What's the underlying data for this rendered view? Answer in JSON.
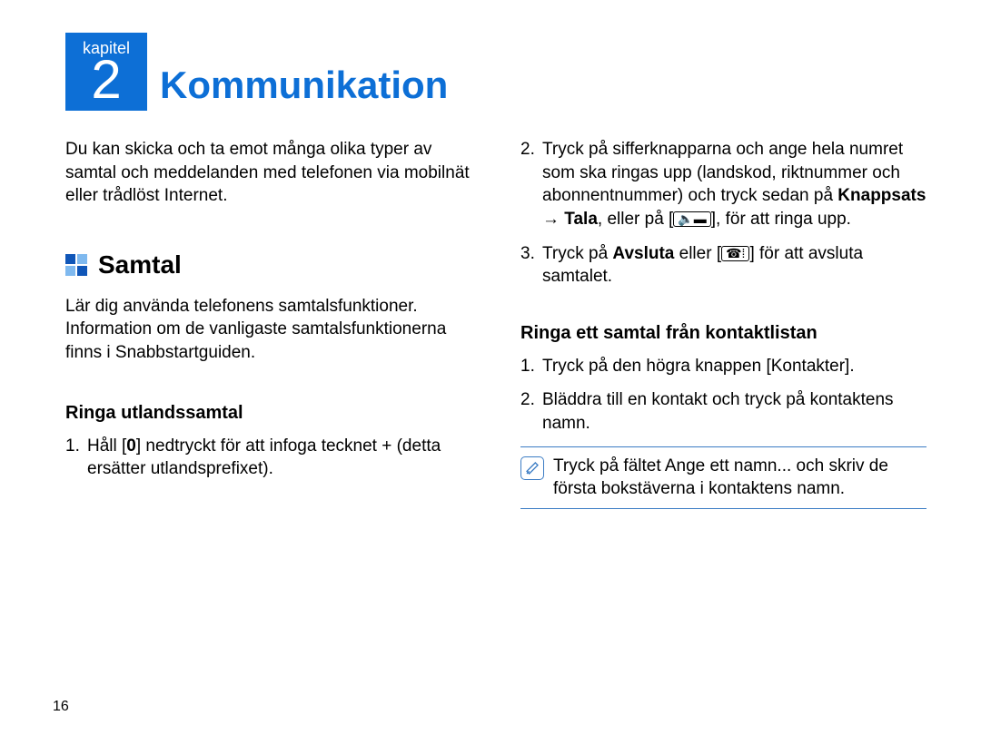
{
  "chapter": {
    "label": "kapitel",
    "number": "2",
    "title": "Kommunikation"
  },
  "left": {
    "intro": "Du kan skicka och ta emot många olika typer av samtal och meddelanden med telefonen via mobilnät eller trådlöst Internet.",
    "section_title": "Samtal",
    "section_text": "Lär dig använda telefonens samtalsfunktioner. Information om de vanligaste samtalsfunktionerna finns i Snabbstartguiden.",
    "sub1_title": "Ringa utlandssamtal",
    "sub1_item1_num": "1.",
    "sub1_item1_a": "Håll [",
    "sub1_item1_bold": "0",
    "sub1_item1_b": "] nedtryckt för att infoga tecknet + (detta ersätter utlandsprefixet)."
  },
  "right": {
    "item2_num": "2.",
    "item2_a": "Tryck på sifferknapparna och ange hela numret som ska ringas upp (landskod, riktnummer och abonnentnummer) och tryck sedan på ",
    "item2_bold1": "Knappsats",
    "item2_arrow": " → ",
    "item2_bold2": "Tala",
    "item2_b": ", eller på [",
    "item2_icon": "🔈▬",
    "item2_c": "], för att ringa upp.",
    "item3_num": "3.",
    "item3_a": "Tryck på ",
    "item3_bold": "Avsluta",
    "item3_b": " eller [",
    "item3_icon": "☎⁞",
    "item3_c": "] för att avsluta samtalet.",
    "sub2_title": "Ringa ett samtal från kontaktlistan",
    "sub2_item1_num": "1.",
    "sub2_item1": "Tryck på den högra knappen [Kontakter].",
    "sub2_item2_num": "2.",
    "sub2_item2": "Bläddra till en kontakt och tryck på kontaktens namn.",
    "note": "Tryck på fältet Ange ett namn... och skriv de första bokstäverna i kontaktens namn."
  },
  "page_number": "16"
}
